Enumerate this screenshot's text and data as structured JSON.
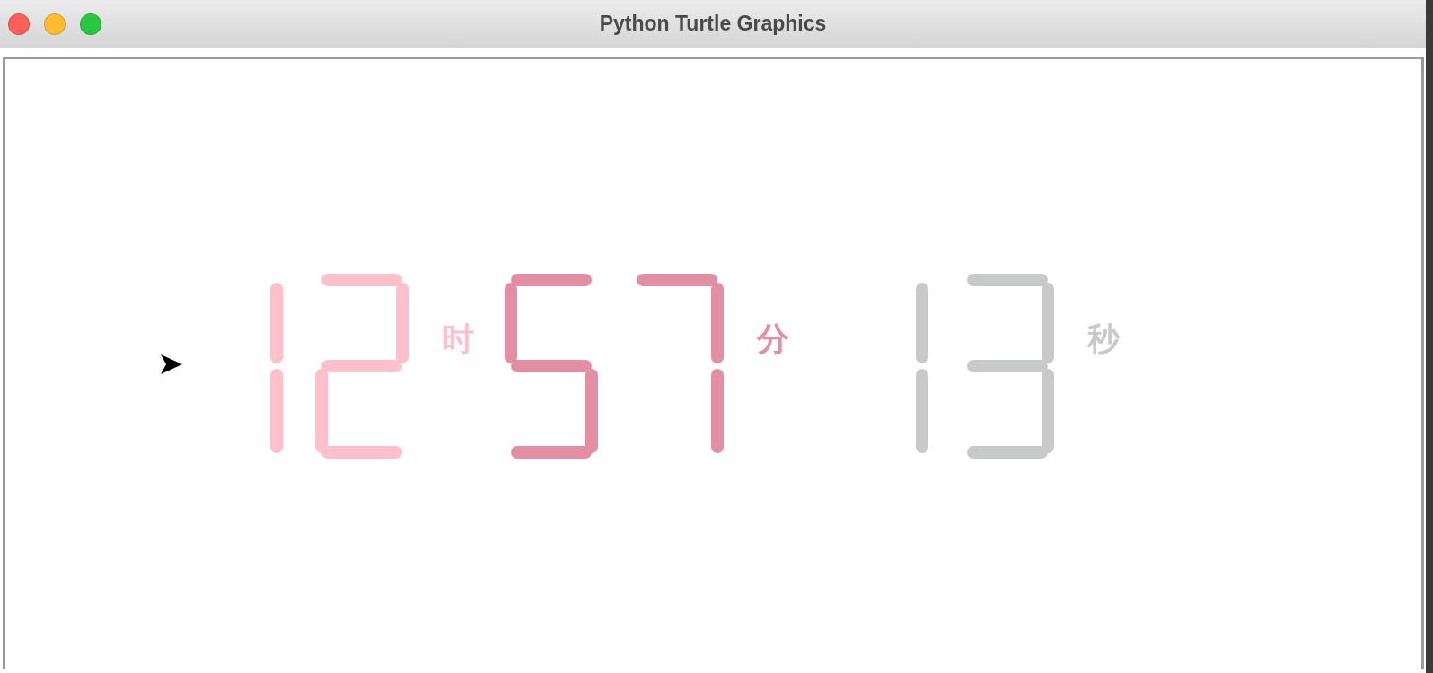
{
  "window": {
    "title": "Python Turtle Graphics"
  },
  "clock": [
    {
      "digits": [
        {
          "b": true,
          "c": true
        },
        {
          "a": true,
          "b": true,
          "d": true,
          "e": true,
          "g": true
        }
      ],
      "unit": "时",
      "color": "#ffc0cb"
    },
    {
      "digits": [
        {
          "a": true,
          "c": true,
          "d": true,
          "f": true,
          "g": true
        },
        {
          "a": true,
          "b": true,
          "c": true
        }
      ],
      "unit": "分",
      "color": "#e48ea3"
    },
    {
      "digits": [
        {
          "b": true,
          "c": true
        },
        {
          "a": true,
          "b": true,
          "c": true,
          "d": true,
          "g": true
        }
      ],
      "unit": "秒",
      "color": "#c8cac9"
    }
  ]
}
